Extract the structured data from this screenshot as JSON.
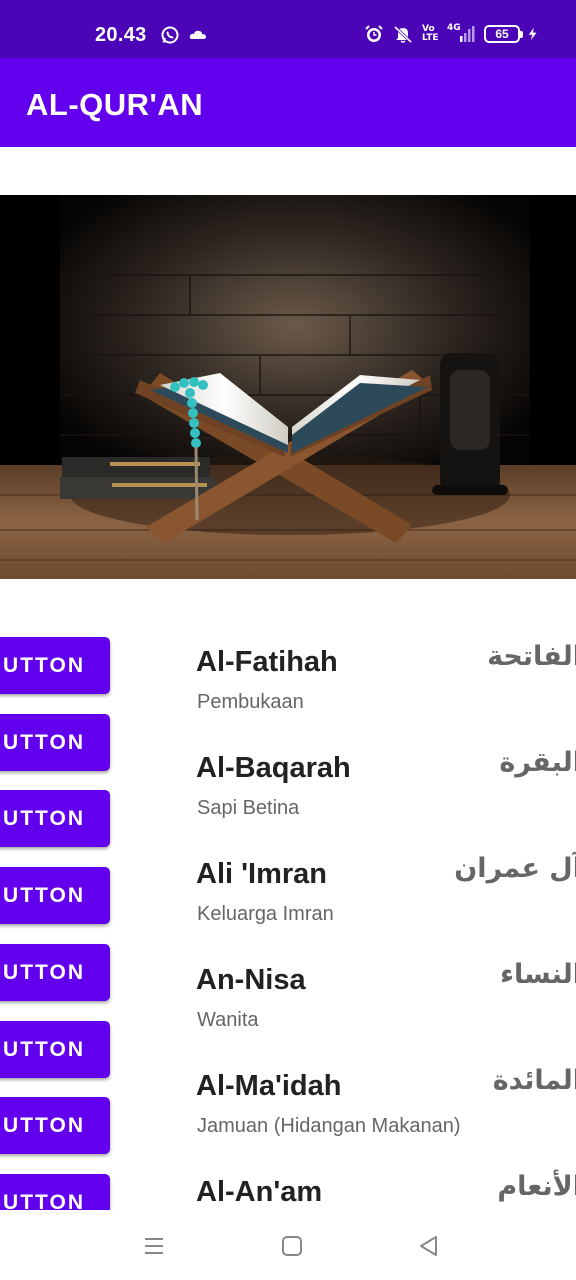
{
  "status_bar": {
    "time": "20.43",
    "icons_left": [
      "whatsapp-icon",
      "cloud-icon"
    ],
    "icons_right": [
      "alarm-icon",
      "mute-icon",
      "volte-icon",
      "4g-signal-icon",
      "battery-icon",
      "charging-icon"
    ],
    "volte_label": "Vo LTE",
    "network_label": "4G",
    "battery_level": "65"
  },
  "app_bar": {
    "title": "AL-QUR'AN",
    "color": "#6200ee"
  },
  "hero_image": {
    "description_icon": "quran-on-rehal-image"
  },
  "surah_list": [
    {
      "button_label": "BUTTON",
      "name": "Al-Fatihah",
      "meaning": "Pembukaan",
      "arabic": "الفاتحة"
    },
    {
      "button_label": "BUTTON",
      "name": "Al-Baqarah",
      "meaning": "Sapi Betina",
      "arabic": "البقرة"
    },
    {
      "button_label": "BUTTON",
      "name": "Ali 'Imran",
      "meaning": "Keluarga Imran",
      "arabic": "آل عمران"
    },
    {
      "button_label": "BUTTON",
      "name": "An-Nisa",
      "meaning": "Wanita",
      "arabic": "النساء"
    },
    {
      "button_label": "BUTTON",
      "name": "Al-Ma'idah",
      "meaning": "Jamuan (Hidangan Makanan)",
      "arabic": "المائدة"
    },
    {
      "button_label": "BUTTON",
      "name": "Al-An'am",
      "meaning": "",
      "arabic": "الأنعام"
    }
  ],
  "nav_bar": {
    "buttons": [
      "menu-icon",
      "home-icon",
      "back-icon"
    ]
  },
  "colors": {
    "status_bar": "#4b05b7",
    "accent": "#6200ee",
    "title_text": "#222222",
    "secondary_text": "#666666"
  }
}
